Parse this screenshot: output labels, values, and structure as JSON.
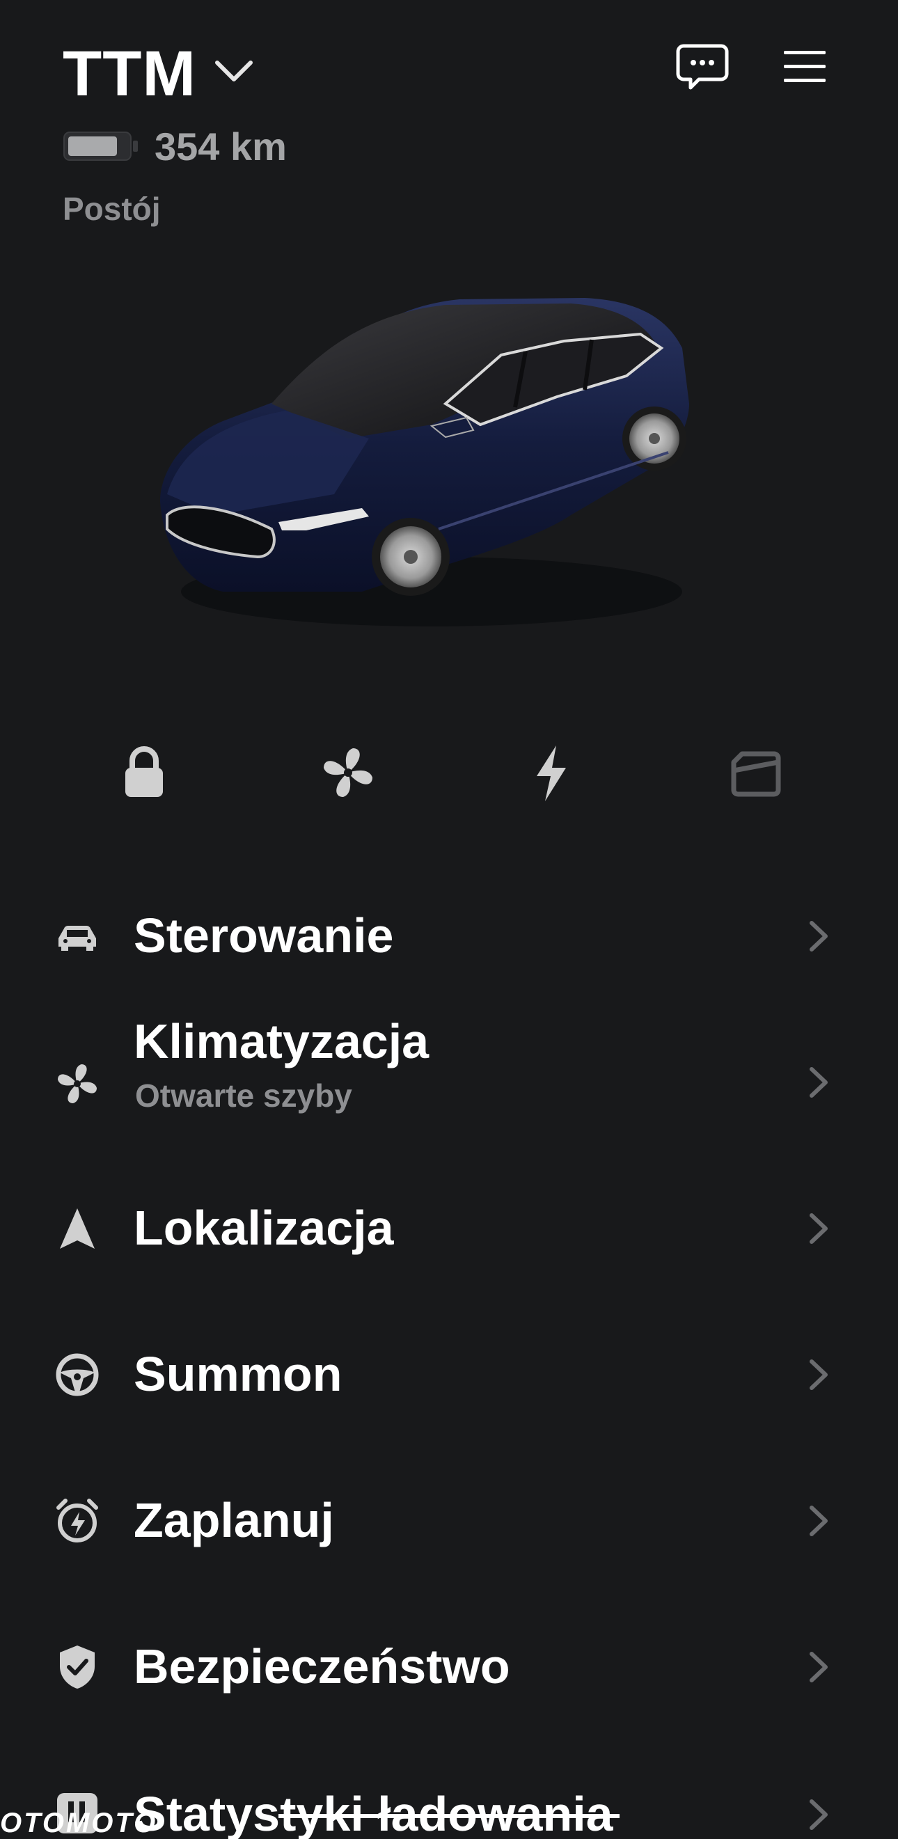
{
  "header": {
    "vehicle_name": "TTM",
    "range": "354 km",
    "status": "Postój",
    "battery_level": 0.88
  },
  "icons": {
    "dropdown": "chevron-down-icon",
    "chat": "chat-icon",
    "menu": "hamburger-menu-icon"
  },
  "quick_actions": [
    {
      "icon": "lock-icon"
    },
    {
      "icon": "fan-icon"
    },
    {
      "icon": "lightning-icon"
    },
    {
      "icon": "frunk-icon"
    }
  ],
  "menu": {
    "items": [
      {
        "label": "Sterowanie",
        "icon": "car-icon"
      },
      {
        "label": "Klimatyzacja",
        "sub": "Otwarte szyby",
        "icon": "fan-icon"
      },
      {
        "label": "Lokalizacja",
        "icon": "navigation-arrow-icon"
      },
      {
        "label": "Summon",
        "icon": "steering-wheel-icon"
      },
      {
        "label": "Zaplanuj",
        "icon": "alarm-clock-icon"
      },
      {
        "label": "Bezpieczeństwo",
        "icon": "shield-icon"
      },
      {
        "label": "Statystyki ładowania",
        "icon": "chart-icon"
      }
    ]
  },
  "watermark": "OTOMOTO",
  "colors": {
    "background": "#18191b",
    "text": "#ffffff",
    "muted": "#8e8f92",
    "car_body": "#141c3d"
  }
}
